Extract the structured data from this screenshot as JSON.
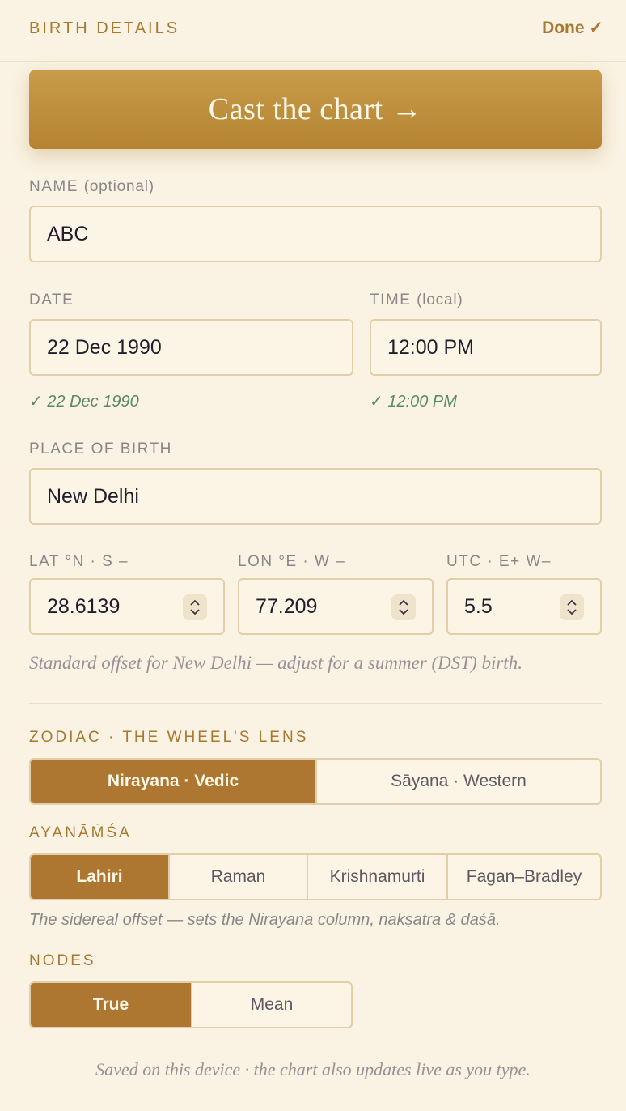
{
  "header": {
    "title": "BIRTH DETAILS",
    "done_label": "Done ✓"
  },
  "cast_button": {
    "label": "Cast the chart →"
  },
  "name": {
    "label": "NAME",
    "label_hint": "(optional)",
    "value": "ABC"
  },
  "date": {
    "label": "DATE",
    "value": "22 Dec 1990",
    "confirmation": "✓ 22 Dec 1990"
  },
  "time": {
    "label": "TIME",
    "label_hint": "(local)",
    "value": "12:00 PM",
    "confirmation": "✓ 12:00 PM"
  },
  "place": {
    "label": "PLACE OF BIRTH",
    "value": "New Delhi"
  },
  "coords": {
    "lat": {
      "label": "LAT °N · S –",
      "value": "28.6139"
    },
    "lon": {
      "label": "LON °E · W –",
      "value": "77.209"
    },
    "utc": {
      "label": "UTC · E+ W–",
      "value": "5.5"
    },
    "note": "Standard offset for New Delhi — adjust for a summer (DST) birth."
  },
  "zodiac": {
    "label": "ZODIAC · THE WHEEL'S LENS",
    "options": [
      "Nirayana · Vedic",
      "Sāyana · Western"
    ],
    "selected": "Nirayana · Vedic"
  },
  "ayanamsa": {
    "label": "AYANĀṀŚA",
    "options": [
      "Lahiri",
      "Raman",
      "Krishnamurti",
      "Fagan–Bradley"
    ],
    "selected": "Lahiri",
    "note": "The sidereal offset — sets the Nirayana column, nakṣatra & daśā."
  },
  "nodes": {
    "label": "NODES",
    "options": [
      "True",
      "Mean"
    ],
    "selected": "True"
  },
  "footer": {
    "note": "Saved on this device · the chart also updates live as you type."
  },
  "colors": {
    "background": "#faf2e2",
    "accent": "#ad7731",
    "accent_text": "#a8782f",
    "confirm_green": "#5a8a62",
    "field_border": "#e2cfa7"
  }
}
